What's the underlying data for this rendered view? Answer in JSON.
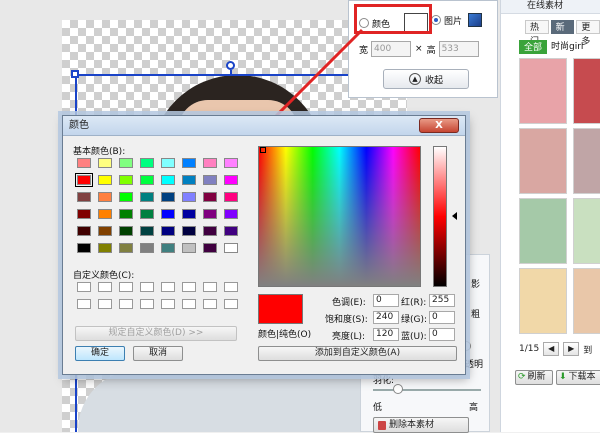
{
  "canvas": {},
  "popup": {
    "color_label": "颜色",
    "image_label": "图片",
    "width_label": "宽",
    "width_value": "400",
    "times": "×",
    "height_label": "高",
    "height_value": "533",
    "collapse_label": "收起"
  },
  "right_panel": {
    "header": "在线素材",
    "tabs": [
      "热门",
      "新鲜",
      "更多"
    ],
    "active_tab_index": 1,
    "filters": [
      "全部",
      "时尚girl"
    ],
    "thumb_colors": [
      "#e8a3a8",
      "#c64b4f",
      "#d9a7a2",
      "#c0a5a6",
      "#a5c9a8",
      "#c9e0c0",
      "#f1d8a8",
      "#e9c7a9"
    ],
    "page": "1/15",
    "page_suffix": "到",
    "refresh_label": "刷新",
    "download_label": "下载本"
  },
  "settings_panel": {
    "shadow_label": "影",
    "thick_label": "粗",
    "transparent_label": "透明",
    "feather_label": "羽化:",
    "low_label": "低",
    "high_label": "高",
    "delete_label": "删除本素材"
  },
  "dialog": {
    "title": "颜色",
    "close_label": "X",
    "basic_colors_label": "基本颜色(B):",
    "basic_colors": [
      [
        "#ff8080",
        "#ffff80",
        "#80ff80",
        "#00ff80",
        "#80ffff",
        "#0080ff",
        "#ff80c0",
        "#ff80ff"
      ],
      [
        "#ff0000",
        "#ffff00",
        "#80ff00",
        "#00ff40",
        "#00ffff",
        "#0080c0",
        "#8080c0",
        "#ff00ff"
      ],
      [
        "#804040",
        "#ff8040",
        "#00ff00",
        "#008080",
        "#004080",
        "#8080ff",
        "#800040",
        "#ff0080"
      ],
      [
        "#800000",
        "#ff8000",
        "#008000",
        "#008040",
        "#0000ff",
        "#0000a0",
        "#800080",
        "#8000ff"
      ],
      [
        "#400000",
        "#804000",
        "#004000",
        "#004040",
        "#000080",
        "#000040",
        "#400040",
        "#400080"
      ],
      [
        "#000000",
        "#808000",
        "#808040",
        "#808080",
        "#408080",
        "#c0c0c0",
        "#400040",
        "#ffffff"
      ]
    ],
    "selected_swatch": [
      1,
      0
    ],
    "custom_colors_label": "自定义颜色(C):",
    "define_custom_label": "规定自定义颜色(D) >>",
    "ok_label": "确定",
    "cancel_label": "取消",
    "color_solid_label": "颜色|纯色(O)",
    "hue_label": "色调(E):",
    "hue_value": "0",
    "sat_label": "饱和度(S):",
    "sat_value": "240",
    "lum_label": "亮度(L):",
    "lum_value": "120",
    "red_label": "红(R):",
    "red_value": "255",
    "green_label": "绿(G):",
    "green_value": "0",
    "blue_label": "蓝(U):",
    "blue_value": "0",
    "add_custom_label": "添加到自定义颜色(A)",
    "current_color": "#ff0000"
  },
  "annotation_color": "#e02424"
}
